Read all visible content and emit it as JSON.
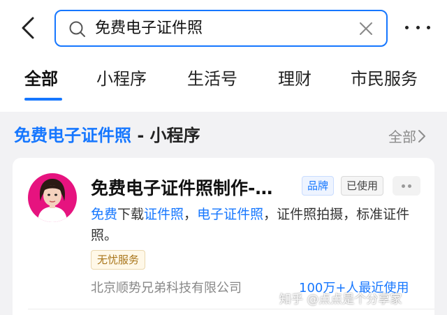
{
  "header": {
    "search_query": "免费电子证件照"
  },
  "tabs": [
    {
      "label": "全部",
      "active": true
    },
    {
      "label": "小程序",
      "active": false
    },
    {
      "label": "生活号",
      "active": false
    },
    {
      "label": "理财",
      "active": false
    },
    {
      "label": "市民服务",
      "active": false
    }
  ],
  "section": {
    "title_highlight": "免费电子证件照",
    "title_rest": " - 小程序",
    "more_label": "全部"
  },
  "result": {
    "name": "免费电子证件照制作-…",
    "badge_brand": "品牌",
    "badge_used": "已使用",
    "description": [
      {
        "text": "免费",
        "kw": true
      },
      {
        "text": "下载",
        "kw": false
      },
      {
        "text": "证件照",
        "kw": true
      },
      {
        "text": "，",
        "kw": false
      },
      {
        "text": "电子证件照",
        "kw": true
      },
      {
        "text": "，证件照拍摄，标准证件照。",
        "kw": false
      }
    ],
    "tag": "无忧服务",
    "company": "北京顺势兄弟科技有限公司",
    "users": "100万+人最近使用"
  },
  "watermark": "知乎 @点点是个分享家",
  "colors": {
    "accent": "#1677ff",
    "avatar_bg": "#e6137f"
  }
}
